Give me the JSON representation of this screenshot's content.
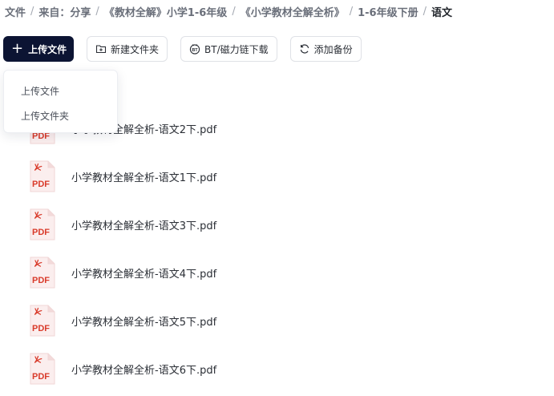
{
  "breadcrumb": [
    {
      "label": "文件"
    },
    {
      "label": "来自：分享"
    },
    {
      "label": "《教材全解》小学1-6年级"
    },
    {
      "label": "《小学教材全解全析》"
    },
    {
      "label": "1-6年级下册"
    },
    {
      "label": "语文"
    }
  ],
  "toolbar": {
    "upload_label": "上传文件",
    "new_folder_label": "新建文件夹",
    "bt_download_label": "BT/磁力链下载",
    "add_backup_label": "添加备份"
  },
  "upload_menu": {
    "items": [
      {
        "label": "上传文件"
      },
      {
        "label": "上传文件夹"
      }
    ]
  },
  "files": [
    {
      "name": "小学教材全解全析-语文2下.pdf",
      "icon": "pdf-icon",
      "icon_text": "PDF"
    },
    {
      "name": "小学教材全解全析-语文1下.pdf",
      "icon": "pdf-icon",
      "icon_text": "PDF"
    },
    {
      "name": "小学教材全解全析-语文3下.pdf",
      "icon": "pdf-icon",
      "icon_text": "PDF"
    },
    {
      "name": "小学教材全解全析-语文4下.pdf",
      "icon": "pdf-icon",
      "icon_text": "PDF"
    },
    {
      "name": "小学教材全解全析-语文5下.pdf",
      "icon": "pdf-icon",
      "icon_text": "PDF"
    },
    {
      "name": "小学教材全解全析-语文6下.pdf",
      "icon": "pdf-icon",
      "icon_text": "PDF"
    }
  ],
  "colors": {
    "primary": "#0c1433",
    "pdf_red": "#d93b2b",
    "pdf_bg": "#fbeeee"
  }
}
